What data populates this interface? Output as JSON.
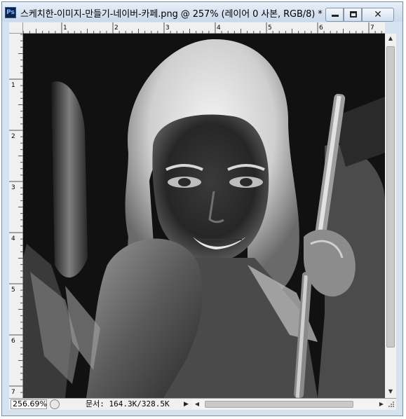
{
  "window": {
    "app_icon_label": "Ps",
    "title": "스케치한-이미지-만들기-네이버-카페.png @ 257% (레이어 0 사본, RGB/8) *",
    "close_glyph": "✕"
  },
  "rulers": {
    "top_ticks": [
      "1",
      "2",
      "3",
      "4",
      "5",
      "6",
      "7"
    ],
    "left_ticks": [
      "1",
      "2",
      "3",
      "4",
      "5",
      "6",
      "7"
    ]
  },
  "canvas": {
    "description_icon": "image-canvas"
  },
  "statusbar": {
    "zoom": "256.69%",
    "doc_info": "문서: 164.3K/328.5K",
    "arrow_glyph": "▶"
  },
  "colors": {
    "titlebar_top": "#e9f0f8",
    "titlebar_bottom": "#c9d8ea",
    "ps_icon": "#0c2348",
    "canvas_bg": "#0e0e0e"
  }
}
